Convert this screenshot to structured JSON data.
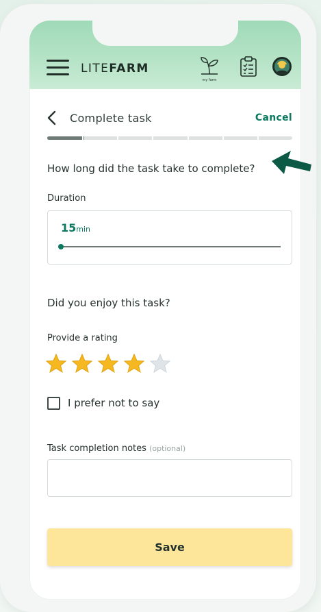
{
  "app": {
    "logo_light": "LITE",
    "logo_bold": "FARM",
    "myfarm_label": "my farm",
    "brand_color": "#0b7a60",
    "header_color": "#a8ddbf",
    "icons": [
      "menu-icon",
      "my-farm-icon",
      "tasks-icon",
      "avatar"
    ]
  },
  "page": {
    "title": "Complete task",
    "cancel_label": "Cancel",
    "step_progress": 0.15,
    "step_count": 7
  },
  "duration": {
    "question": "How long did the task take to complete?",
    "label": "Duration",
    "value": "15",
    "unit": "min",
    "slider_fraction": 0.0
  },
  "rating": {
    "question": "Did you enjoy this task?",
    "label": "Provide a rating",
    "value": 4,
    "max": 5,
    "filled_color": "#f5b821",
    "empty_color": "#dfe4e8"
  },
  "prefer_not": {
    "label": "I prefer not to say",
    "checked": false
  },
  "notes": {
    "label": "Task completion notes",
    "optional": "(optional)",
    "value": ""
  },
  "save": {
    "label": "Save",
    "color": "#fde69a"
  }
}
